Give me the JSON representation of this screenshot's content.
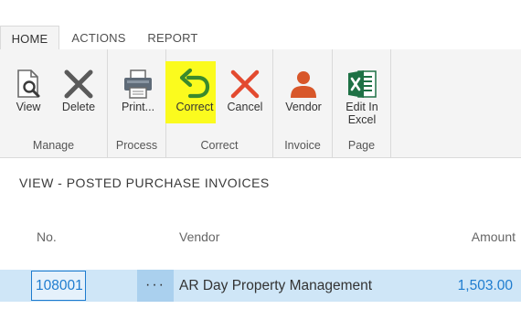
{
  "tabs": [
    {
      "label": "HOME",
      "active": true
    },
    {
      "label": "ACTIONS",
      "active": false
    },
    {
      "label": "REPORT",
      "active": false
    }
  ],
  "ribbon": {
    "groups": [
      {
        "label": "Manage",
        "buttons": [
          {
            "label": "View",
            "icon": "view-document-icon"
          },
          {
            "label": "Delete",
            "icon": "delete-x-icon"
          }
        ]
      },
      {
        "label": "Process",
        "buttons": [
          {
            "label": "Print...",
            "icon": "printer-icon"
          }
        ]
      },
      {
        "label": "Correct",
        "buttons": [
          {
            "label": "Correct",
            "icon": "undo-arrow-icon"
          },
          {
            "label": "Cancel",
            "icon": "cancel-x-icon"
          }
        ]
      },
      {
        "label": "Invoice",
        "buttons": [
          {
            "label": "Vendor",
            "icon": "person-icon"
          }
        ]
      },
      {
        "label": "Page",
        "buttons": [
          {
            "label": "Edit In Excel",
            "label_lines": [
              "Edit In",
              "Excel"
            ],
            "icon": "excel-icon"
          }
        ]
      }
    ]
  },
  "view": {
    "title": "VIEW - POSTED PURCHASE INVOICES",
    "columns": {
      "no": "No.",
      "vendor": "Vendor",
      "amount": "Amount"
    },
    "rows": [
      {
        "no": "108001",
        "menu": "···",
        "vendor": "AR Day Property Management",
        "amount": "1,503.00"
      }
    ]
  },
  "colors": {
    "accent_blue": "#1e7ccf",
    "delete_gray": "#5a5a5a",
    "cancel_red": "#e34a2f",
    "undo_green": "#3a8a2c",
    "person_orange": "#d8572a",
    "excel_green": "#1e7145",
    "highlight_yellow": "#fbfb1e",
    "row_selected": "#cfe6f7"
  }
}
